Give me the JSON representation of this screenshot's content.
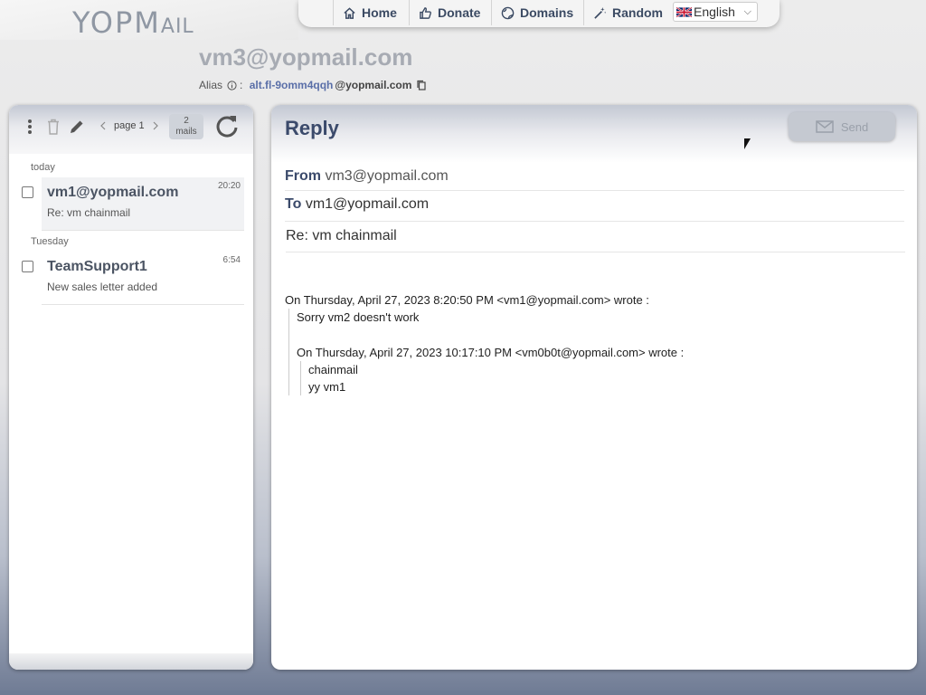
{
  "logo": {
    "text_main": "YOPM",
    "text_small": "AIL"
  },
  "nav": {
    "items": [
      {
        "label": "Home",
        "icon": "home-icon"
      },
      {
        "label": "Donate",
        "icon": "thumbs-up-icon"
      },
      {
        "label": "Domains",
        "icon": "globe-icon"
      },
      {
        "label": "Random",
        "icon": "magic-wand-icon"
      }
    ],
    "language": {
      "selected": "English",
      "flag": "uk-flag-icon"
    }
  },
  "mailbox": {
    "address": "vm3@yopmail.com",
    "alias_label": "Alias",
    "alias_sep": ":",
    "alias_local": "alt.fl-9omm4qqh",
    "alias_domain": "@yopmail.com"
  },
  "toolbar": {
    "page_label": "page 1",
    "mail_count": "2",
    "mail_count_unit": "mails"
  },
  "inbox": {
    "groups": [
      {
        "label": "today",
        "mails": [
          {
            "from": "vm1@yopmail.com",
            "subject": "Re: vm chainmail",
            "time": "20:20",
            "selected": true
          }
        ]
      },
      {
        "label": "Tuesday",
        "mails": [
          {
            "from": "TeamSupport1",
            "subject": "New sales letter added",
            "time": "6:54",
            "selected": false
          }
        ]
      }
    ]
  },
  "reply": {
    "title": "Reply",
    "send_label": "Send",
    "from_label": "From",
    "from_value": "vm3@yopmail.com",
    "to_label": "To",
    "to_value": "vm1@yopmail.com",
    "subject": "Re: vm chainmail",
    "quote": {
      "header1": "On Thursday, April 27, 2023 8:20:50 PM <vm1@yopmail.com> wrote :",
      "line1": "Sorry vm2 doesn't work",
      "header2": "On Thursday, April 27, 2023 10:17:10 PM <vm0b0t@yopmail.com> wrote :",
      "line2": "chainmail",
      "line3": "yy vm1"
    }
  },
  "colors": {
    "accent": "#3b4a6b",
    "alias_link": "#5a6fa8",
    "title_gray": "#a7abb3"
  }
}
